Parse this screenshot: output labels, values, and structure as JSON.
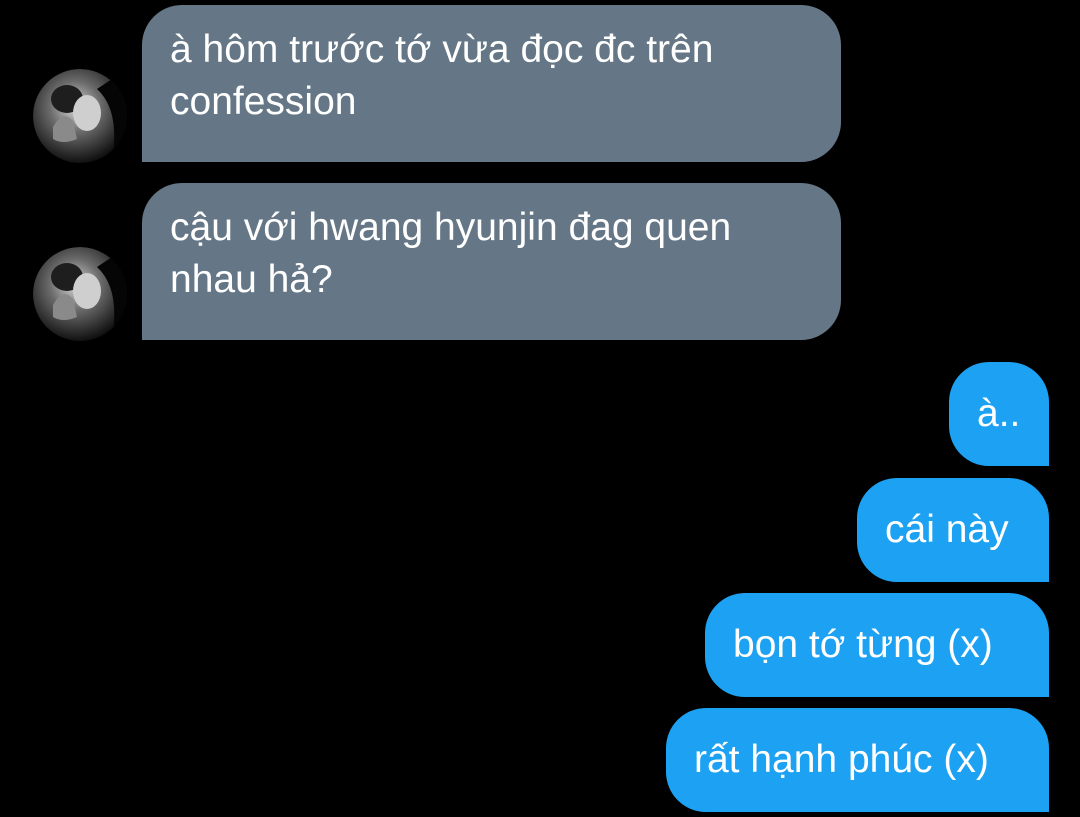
{
  "conversation": {
    "incoming": [
      {
        "lines": [
          "à hôm trước tớ vừa đọc đc trên",
          "confession"
        ]
      },
      {
        "lines": [
          "cậu với hwang hyunjin đag quen",
          "nhau hả?"
        ]
      }
    ],
    "outgoing": [
      {
        "text": "à.."
      },
      {
        "text": "cái này"
      },
      {
        "text": "bọn tớ từng (x)"
      },
      {
        "text": "rất hạnh phúc (x)"
      }
    ]
  },
  "colors": {
    "background": "#000000",
    "incoming_bubble": "#657786",
    "outgoing_bubble": "#1da1f2",
    "text": "#ffffff"
  },
  "icons": {
    "avatar": "contact-avatar-photo"
  }
}
